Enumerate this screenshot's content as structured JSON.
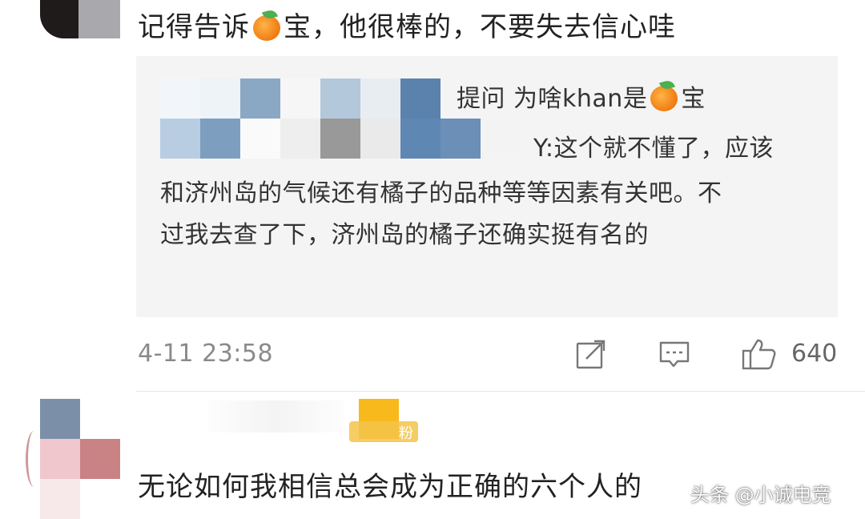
{
  "top_comment": {
    "text_before": "记得告诉",
    "text_after": "宝，他很棒的，不要失去信心哇",
    "emoji": "tangerine-emoji"
  },
  "reply": {
    "question_prefix": "提问 为啥khan是",
    "question_suffix": "宝",
    "answer_tail": "Y:这个就不懂了，应该",
    "line2": "和济州岛的气候还有橘子的品种等等因素有关吧。不",
    "line3": "过我去查了下，济州岛的橘子还确实挺有名的"
  },
  "meta": {
    "date": "4-11 23:58",
    "like_count": "640"
  },
  "second_comment": {
    "badge": "粉",
    "text": "无论如何我相信总会成为正确的六个人的"
  },
  "watermark": "头条 @小诚电竞",
  "colors": {
    "reply_bg": "#f4f4f4",
    "meta_gray": "#8a8a8a",
    "badge_yellow": "#f8b91c"
  }
}
